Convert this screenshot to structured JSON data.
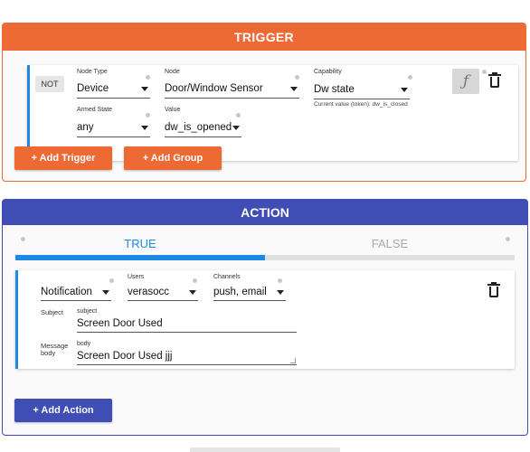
{
  "trigger": {
    "title": "TRIGGER",
    "not_label": "NOT",
    "node_type": {
      "label": "Node Type",
      "value": "Device"
    },
    "node": {
      "label": "Node",
      "value": "Door/Window Sensor"
    },
    "capability": {
      "label": "Capability",
      "value": "Dw state",
      "current_value_note": "Current value (token): dw_is_closed"
    },
    "armed_state": {
      "label": "Armed State",
      "value": "any"
    },
    "value": {
      "label": "Value",
      "value": "dw_is_opened"
    },
    "function_icon": "function-icon",
    "add_trigger": "+  Add Trigger",
    "add_group": "+  Add Group"
  },
  "action": {
    "title": "ACTION",
    "tabs": {
      "true_label": "TRUE",
      "false_label": "FALSE",
      "selected": "TRUE"
    },
    "notification_type": "Notification",
    "users": {
      "label": "Users",
      "value": "verasocc"
    },
    "channels": {
      "label": "Channels",
      "value": "push, email"
    },
    "subject": {
      "label": "Subject",
      "field_label": "subject",
      "value": "Screen Door Used"
    },
    "message_body": {
      "label": "Message body",
      "field_label": "body",
      "value": "Screen Door Used jjj"
    },
    "add_action": "+  Add Action"
  },
  "colors": {
    "trigger_accent": "#ee6a35",
    "action_accent": "#3f4db5",
    "tab_indicator": "#1e88e5"
  }
}
